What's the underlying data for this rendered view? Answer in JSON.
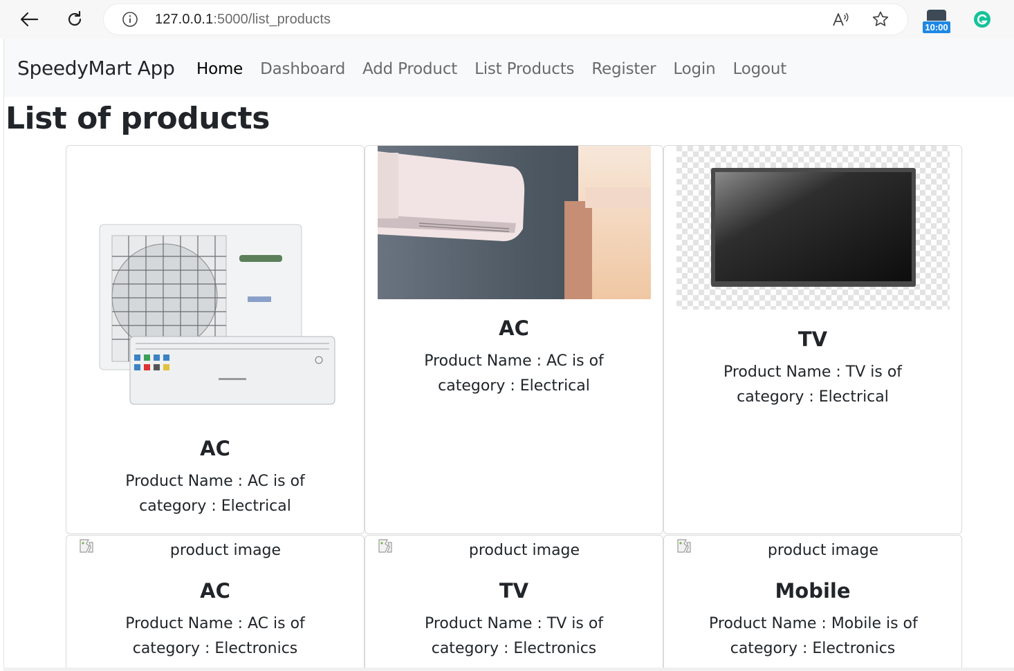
{
  "browser": {
    "url_host": "127.0.0.1",
    "url_path": ":5000/list_products",
    "timer_badge": "10:00"
  },
  "navbar": {
    "brand": "SpeedyMart App",
    "links": [
      {
        "label": "Home"
      },
      {
        "label": "Dashboard"
      },
      {
        "label": "Add Product"
      },
      {
        "label": "List Products"
      },
      {
        "label": "Register"
      },
      {
        "label": "Login"
      },
      {
        "label": "Logout"
      }
    ]
  },
  "page": {
    "title": "List of products"
  },
  "products": [
    {
      "title": "AC",
      "text_line1": "Product Name : AC is of",
      "text_line2": "category : Electrical",
      "image": "air-conditioner-split-unit"
    },
    {
      "title": "AC",
      "text_line1": "Product Name : AC is of",
      "text_line2": "category : Electrical",
      "image": "wall-mounted-ac-room"
    },
    {
      "title": "TV",
      "text_line1": "Product Name : TV is of",
      "text_line2": "category : Electrical",
      "image": "flat-screen-tv"
    },
    {
      "title": "AC",
      "text_line1": "Product Name : AC is of",
      "text_line2": "category : Electronics",
      "image_alt": "product image"
    },
    {
      "title": "TV",
      "text_line1": "Product Name : TV is of",
      "text_line2": "category : Electronics",
      "image_alt": "product image"
    },
    {
      "title": "Mobile",
      "text_line1": "Product Name : Mobile is of",
      "text_line2": "category : Electronics",
      "image_alt": "product image"
    }
  ]
}
